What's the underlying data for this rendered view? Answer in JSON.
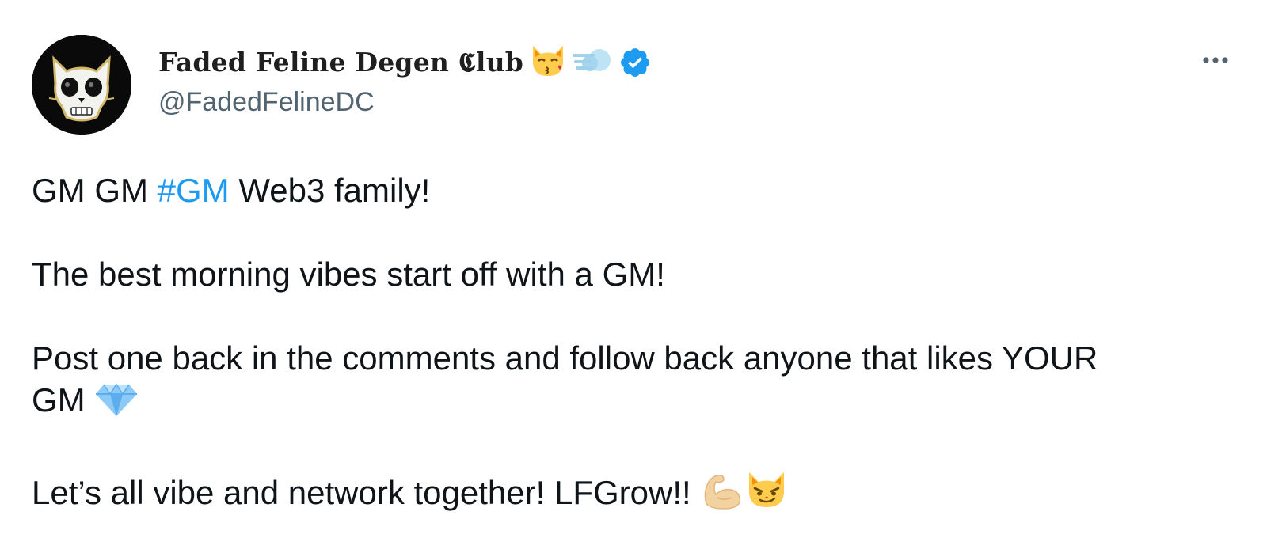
{
  "tweet": {
    "author": {
      "display_name": "Faded Feline Degen 𝕮lub",
      "handle": "@FadedFelineDC",
      "name_emojis": [
        "kissing-cat-emoji",
        "dash-emoji"
      ],
      "verified": true
    },
    "more_label": "More",
    "lines": {
      "l1_pre": "GM GM ",
      "l1_hashtag": "#GM",
      "l1_post": " Web3 family!",
      "l2": "The best morning vibes start off with a GM!",
      "l3": "Post one back in the comments and follow back anyone that likes YOUR",
      "l4": "GM",
      "l5": "Let’s all vibe and network together! LFGrow!!"
    },
    "icons": {
      "avatar": "skull-cat-avatar",
      "verified": "verified-badge-icon",
      "more": "more-icon",
      "gem": "gem-emoji",
      "flexed_biceps": "flexed-biceps-emoji",
      "smirking_cat": "smirking-cat-emoji"
    },
    "colors": {
      "text": "#0f1419",
      "secondary": "#536471",
      "link": "#1d9bf0",
      "verified": "#1d9bf0"
    }
  }
}
